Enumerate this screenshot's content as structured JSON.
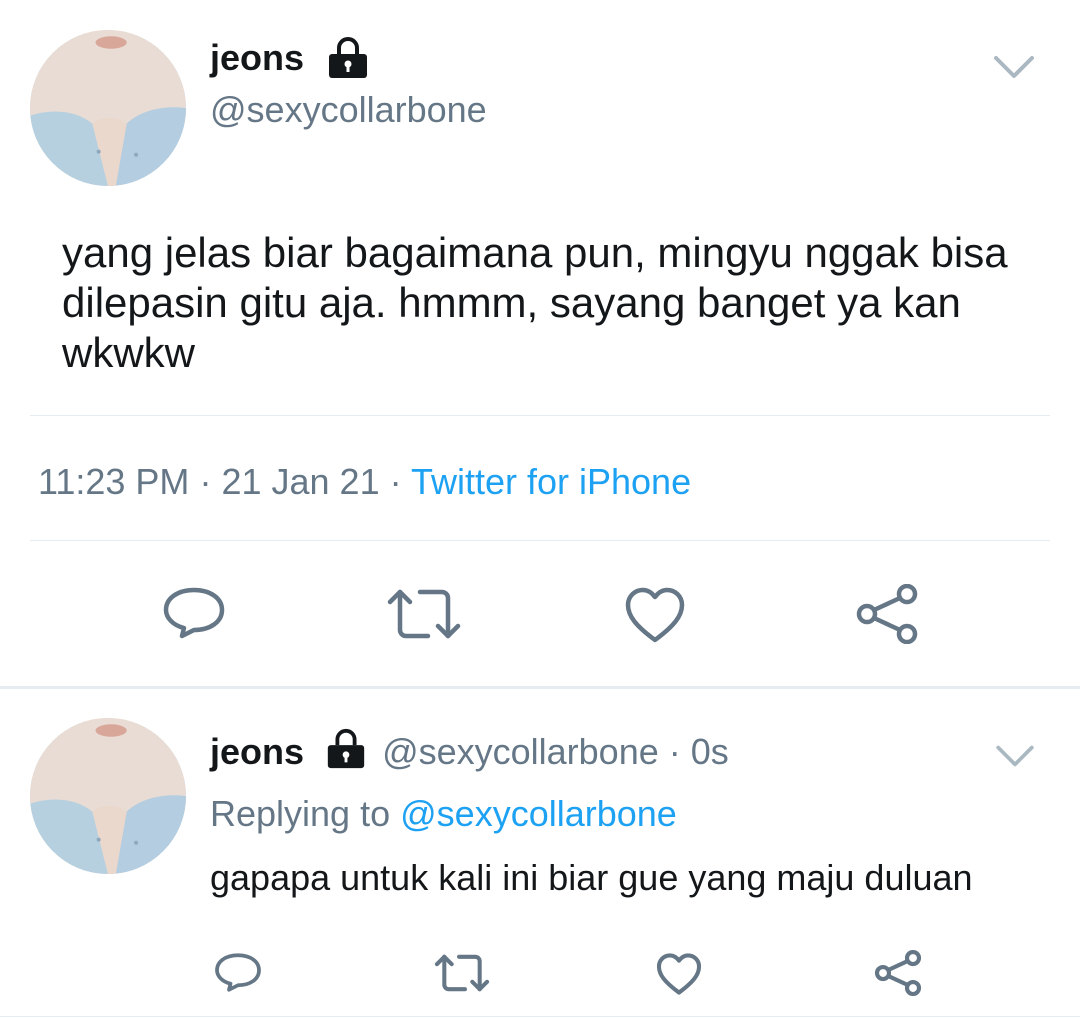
{
  "main_tweet": {
    "display_name": "jeons",
    "handle": "@sexycollarbone",
    "text": "yang jelas biar bagaimana pun, mingyu nggak bisa dilepasin gitu aja. hmmm, sayang banget ya kan wkwkw",
    "time": "11:23 PM",
    "sep1": "·",
    "date": "21 Jan 21",
    "sep2": "·",
    "source": "Twitter for iPhone",
    "icons": [
      "reply-icon",
      "retweet-icon",
      "like-icon",
      "share-icon",
      "lock-icon",
      "chevron-down-icon"
    ]
  },
  "reply_tweet": {
    "display_name": "jeons",
    "handle": "@sexycollarbone",
    "sep": "·",
    "time_ago": "0s",
    "replying_label": "Replying to",
    "replying_handle": "@sexycollarbone",
    "text": "gapapa untuk kali ini biar gue yang maju duluan"
  },
  "colors": {
    "text": "#14171a",
    "muted": "#657786",
    "link": "#1da1f2",
    "divider": "#e6ecf0"
  }
}
